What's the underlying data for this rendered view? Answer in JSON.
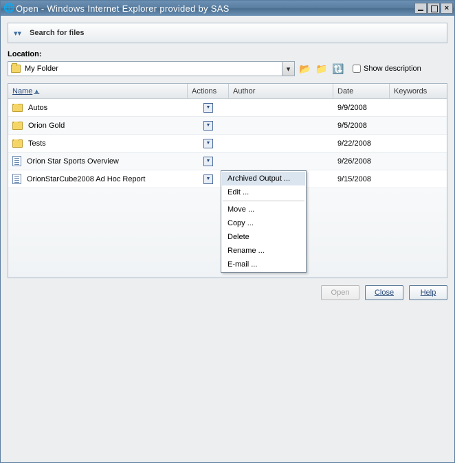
{
  "window": {
    "title": "Open - Windows Internet Explorer provided by SAS"
  },
  "search": {
    "label": "Search for files"
  },
  "location": {
    "label": "Location:",
    "selected": "My Folder",
    "show_description_label": "Show description"
  },
  "grid": {
    "headers": {
      "name": "Name",
      "actions": "Actions",
      "author": "Author",
      "date": "Date",
      "keywords": "Keywords"
    },
    "rows": [
      {
        "type": "folder",
        "name": "Autos",
        "date": "9/9/2008"
      },
      {
        "type": "folder",
        "name": "Orion Gold",
        "date": "9/5/2008"
      },
      {
        "type": "folder",
        "name": "Tests",
        "date": "9/22/2008"
      },
      {
        "type": "doc",
        "name": "Orion Star Sports Overview",
        "date": "9/26/2008"
      },
      {
        "type": "doc",
        "name": "OrionStarCube2008 Ad Hoc Report",
        "date": "9/15/2008"
      }
    ]
  },
  "context_menu": {
    "items": [
      "Archived Output ...",
      "Edit ...",
      "Move ...",
      "Copy ...",
      "Delete",
      "Rename ...",
      "E-mail ..."
    ]
  },
  "buttons": {
    "open": "Open",
    "close": "Close",
    "help": "Help"
  }
}
